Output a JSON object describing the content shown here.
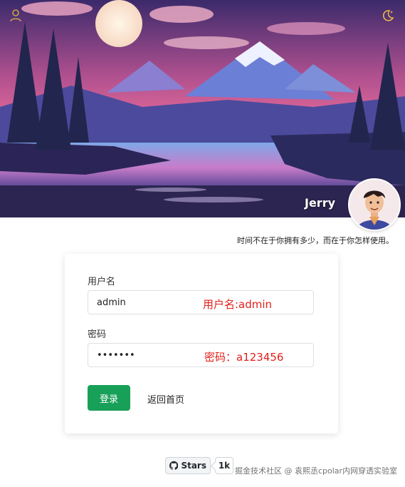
{
  "header": {
    "author_name": "Jerry",
    "user_icon": "user-icon",
    "theme_icon": "moon-icon",
    "avatar": "avatar"
  },
  "motto": "时间不在于你拥有多少，而在于你怎样使用。",
  "login": {
    "username_label": "用户名",
    "username_value": "admin",
    "username_annotation": "用户名:admin",
    "password_label": "密码",
    "password_value": "•••••••",
    "password_annotation": "密码：a123456",
    "submit_label": "登录",
    "back_label": "返回首页"
  },
  "github": {
    "icon": "github-icon",
    "stars_label": "Stars",
    "stars_count": "1k"
  },
  "watermark": "掘金技术社区 @ 袁熙丞cpolar内网穿透实验室",
  "colors": {
    "primary": "#18a058",
    "annotation": "#e0201c",
    "icon_gold": "#c9a44a"
  }
}
